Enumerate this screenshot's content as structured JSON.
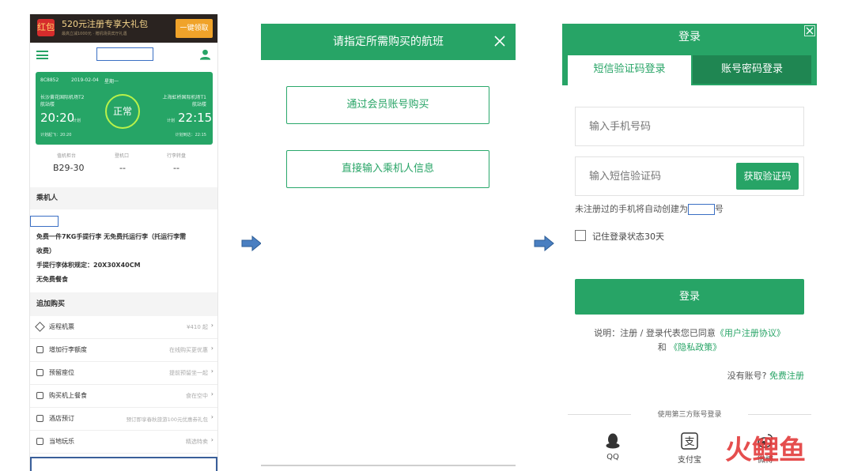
{
  "colors": {
    "accent": "#27a466",
    "accent_dark": "#1f8652",
    "highlight_box": "#3a6fc4",
    "status_ring": "#b9f24a",
    "banner_button": "#f0a32a",
    "watermark": "#e33b3b"
  },
  "panel1": {
    "banner": {
      "title": "520元注册专享大礼包",
      "subtitle": "最高立减1000元 · 赠机场贵宾厅礼遇",
      "button": "一键领取",
      "gift_icon": "红包"
    },
    "flight": {
      "number": "8C8852",
      "date": "2019-02-04",
      "weekday": "星期一",
      "dep_airport": "长沙黄花国际机场T2",
      "dep_terminal": "航站楼",
      "arr_airport": "上海虹桥国际机场T1",
      "arr_terminal": "航站楼",
      "dep_time": "20:20",
      "dep_tag": "计划",
      "arr_tag": "计划",
      "arr_time": "22:15",
      "status": "正常",
      "planned_dep": "计划起飞：20:20",
      "planned_arr": "计划到达：22:15"
    },
    "gate": {
      "checkin_label": "值机柜台",
      "checkin_value": "B29-30",
      "boarding_label": "登机口",
      "boarding_value": "--",
      "baggage_label": "行李转盘",
      "baggage_value": "--"
    },
    "passenger_section": "乘机人",
    "baggage_info": [
      "免费一件7KG手提行李 无免费托运行李（托运行李需",
      "收费）",
      "手提行李体积规定：20X30X40CM",
      "无免费餐食"
    ],
    "addon_section": "追加购买",
    "addons": [
      {
        "label": "返程机票",
        "right": "¥410 起"
      },
      {
        "label": "增加行李额度",
        "right": "在线购买更优惠"
      },
      {
        "label": "预留座位",
        "right": "提前预留坐一起"
      },
      {
        "label": "购买机上餐食",
        "right": "食在空中"
      },
      {
        "label": "酒店预订",
        "right": "预订即享春秋旅游100元优惠券礼包"
      },
      {
        "label": "当地玩乐",
        "right": "精选特卖"
      }
    ]
  },
  "panel2": {
    "title": "请指定所需购买的航班",
    "btn_member": "通过会员账号购买",
    "btn_direct": "直接输入乘机人信息"
  },
  "panel3": {
    "title": "登录",
    "tab_sms": "短信验证码登录",
    "tab_password": "账号密码登录",
    "phone_placeholder": "输入手机号码",
    "code_placeholder": "输入短信验证码",
    "get_code": "获取验证码",
    "note_before": "未注册过的手机将自动创建为",
    "note_after": "号",
    "remember": "记住登录状态30天",
    "login": "登录",
    "agree_prefix": "说明：注册 / 登录代表您已同意",
    "agree_user": "《用户注册协议》",
    "agree_and": "和",
    "agree_privacy": "《隐私政策》",
    "no_account": "没有账号?",
    "register": "免费注册",
    "third_party": "使用第三方账号登录",
    "qq": "QQ",
    "alipay": "支付宝",
    "weibo": "微博",
    "alipay_glyph": "支"
  },
  "watermark": "火鲤鱼"
}
